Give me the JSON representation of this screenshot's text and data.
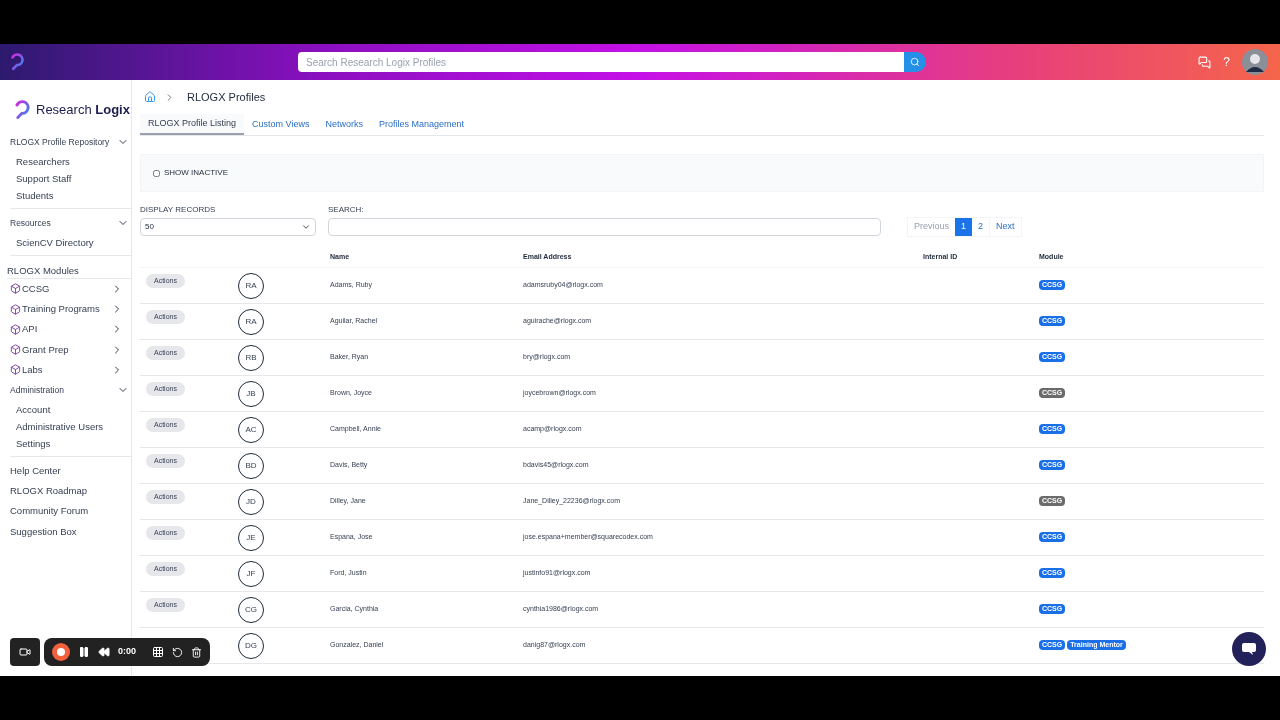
{
  "header": {
    "search_placeholder": "Search Research Logix Profiles",
    "help": "?"
  },
  "sidebar": {
    "logo": "Research **Logix**",
    "items": [
      {
        "kind": "group",
        "label": "RLOGX Profile Repository",
        "expanded": true,
        "children": [
          {
            "label": "Researchers"
          },
          {
            "label": "Support Staff"
          },
          {
            "label": "Students"
          }
        ]
      },
      {
        "kind": "group",
        "label": "Resources",
        "expanded": true,
        "children": [
          {
            "label": "ScienCV Directory"
          }
        ]
      },
      {
        "kind": "heading",
        "label": "RLOGX Modules"
      },
      {
        "kind": "module",
        "label": "CCSG"
      },
      {
        "kind": "module",
        "label": "Training Programs"
      },
      {
        "kind": "module",
        "label": "API"
      },
      {
        "kind": "module",
        "label": "Grant Prep"
      },
      {
        "kind": "module",
        "label": "Labs"
      },
      {
        "kind": "group",
        "label": "Administration",
        "expanded": true,
        "children": [
          {
            "label": "Account"
          },
          {
            "label": "Administrative Users"
          },
          {
            "label": "Settings"
          }
        ]
      },
      {
        "kind": "link",
        "label": "Help Center"
      },
      {
        "kind": "link",
        "label": "RLOGX Roadmap"
      },
      {
        "kind": "link",
        "label": "Community Forum"
      },
      {
        "kind": "link",
        "label": "Suggestion Box"
      }
    ]
  },
  "breadcrumb": "RLOGX Profiles",
  "tabs": [
    {
      "label": "RLOGX Profile Listing",
      "selected": true
    },
    {
      "label": "Custom Views",
      "selected": false
    },
    {
      "label": "Networks",
      "selected": false
    },
    {
      "label": "Profiles Management",
      "selected": false
    }
  ],
  "filter": {
    "label": "SHOW INACTIVE",
    "checked": false
  },
  "display_records": {
    "label": "DISPLAY RECORDS",
    "value": "50"
  },
  "search": {
    "label": "SEARCH:"
  },
  "pagination": {
    "previous": {
      "label": "Previous",
      "disabled": true
    },
    "pages": [
      {
        "label": "1",
        "selected": true
      },
      {
        "label": "2",
        "selected": false
      }
    ],
    "next": {
      "label": "Next",
      "disabled": false
    }
  },
  "table": {
    "columns": [
      "Name",
      "Email Address",
      "Internal ID",
      "Module"
    ],
    "rows": [
      {
        "action": "Actions",
        "initials": "RA",
        "name": "Adams, Ruby",
        "email": "adamsruby04@rlogx.com",
        "modules": [
          {
            "label": "CCSG",
            "color": "#1a6fe8"
          }
        ]
      },
      {
        "action": "Actions",
        "initials": "RA",
        "name": "Aguilar, Rachel",
        "email": "aguirache@rlogx.com",
        "modules": [
          {
            "label": "CCSG",
            "color": "#1a6fe8"
          }
        ]
      },
      {
        "action": "Actions",
        "initials": "RB",
        "name": "Baker, Ryan",
        "email": "bry@rlogx.com",
        "modules": [
          {
            "label": "CCSG",
            "color": "#1a6fe8"
          }
        ]
      },
      {
        "action": "Actions",
        "initials": "JB",
        "name": "Brown, Joyce",
        "email": "joycebrown@rlogx.com",
        "modules": [
          {
            "label": "CCSG",
            "color": "#6b6b6b"
          }
        ]
      },
      {
        "action": "Actions",
        "initials": "AC",
        "name": "Campbell, Annie",
        "email": "acamp@rlogx.com",
        "modules": [
          {
            "label": "CCSG",
            "color": "#1a6fe8"
          }
        ]
      },
      {
        "action": "Actions",
        "initials": "BD",
        "name": "Davis, Betty",
        "email": "bdavis45@rlogx.com",
        "modules": [
          {
            "label": "CCSG",
            "color": "#1a6fe8"
          }
        ]
      },
      {
        "action": "Actions",
        "initials": "JD",
        "name": "Dilley, Jane",
        "email": "Jane_Dilley_22236@rlogx.com",
        "modules": [
          {
            "label": "CCSG",
            "color": "#6b6b6b"
          }
        ]
      },
      {
        "action": "Actions",
        "initials": "JE",
        "name": "Espana, Jose",
        "email": "jose.espana+member@squarecodex.com",
        "modules": [
          {
            "label": "CCSG",
            "color": "#1a6fe8"
          }
        ]
      },
      {
        "action": "Actions",
        "initials": "JF",
        "name": "Ford, Justin",
        "email": "justinfo91@rlogx.com",
        "modules": [
          {
            "label": "CCSG",
            "color": "#1a6fe8"
          }
        ]
      },
      {
        "action": "Actions",
        "initials": "CG",
        "name": "Garcia, Cynthia",
        "email": "cynthia1986@rlogx.com",
        "modules": [
          {
            "label": "CCSG",
            "color": "#1a6fe8"
          }
        ]
      },
      {
        "initials": "DG",
        "name": "Gonzalez, Daniel",
        "email": "danig87@rlogx.com",
        "modules": [
          {
            "label": "CCSG",
            "color": "#1a6fe8"
          },
          {
            "label": "Training Mentor",
            "color": "#1a6fe8"
          }
        ]
      }
    ]
  },
  "recorder": {
    "time": "0:00"
  }
}
